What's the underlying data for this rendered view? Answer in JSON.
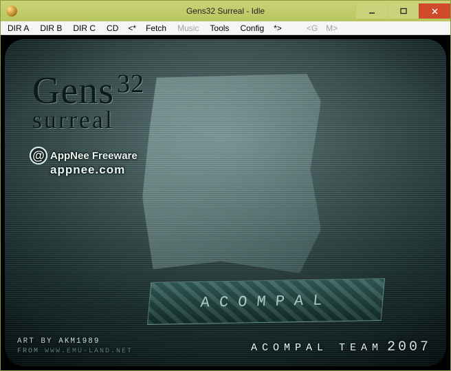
{
  "window": {
    "title": "Gens32 Surreal - Idle"
  },
  "menu": {
    "items": [
      {
        "label": "DIR A",
        "disabled": false
      },
      {
        "label": "DIR B",
        "disabled": false
      },
      {
        "label": "DIR C",
        "disabled": false
      },
      {
        "label": "CD",
        "disabled": false
      },
      {
        "label": "<*",
        "disabled": false,
        "punct": true
      },
      {
        "label": "Fetch",
        "disabled": false
      },
      {
        "label": "Music",
        "disabled": true
      },
      {
        "label": "Tools",
        "disabled": false
      },
      {
        "label": "Config",
        "disabled": false
      },
      {
        "label": "*>",
        "disabled": false,
        "punct": true
      },
      {
        "label": "<G",
        "disabled": true,
        "punct": true
      },
      {
        "label": "M>",
        "disabled": true,
        "punct": true
      }
    ]
  },
  "splash": {
    "logo_line1_a": "Gens",
    "logo_line1_b": "32",
    "logo_line2": "surreal",
    "watermark_line1": "AppNee Freeware",
    "watermark_line2": "appnee.com",
    "banner_text": "ACOMPAL",
    "art_by_label": "ART BY",
    "art_by_value": "AKM1989",
    "from_label": "FROM",
    "from_url": "WWW.EMU-LAND.NET",
    "team_label": "ACOMPAL TEAM",
    "team_year": "2007"
  }
}
